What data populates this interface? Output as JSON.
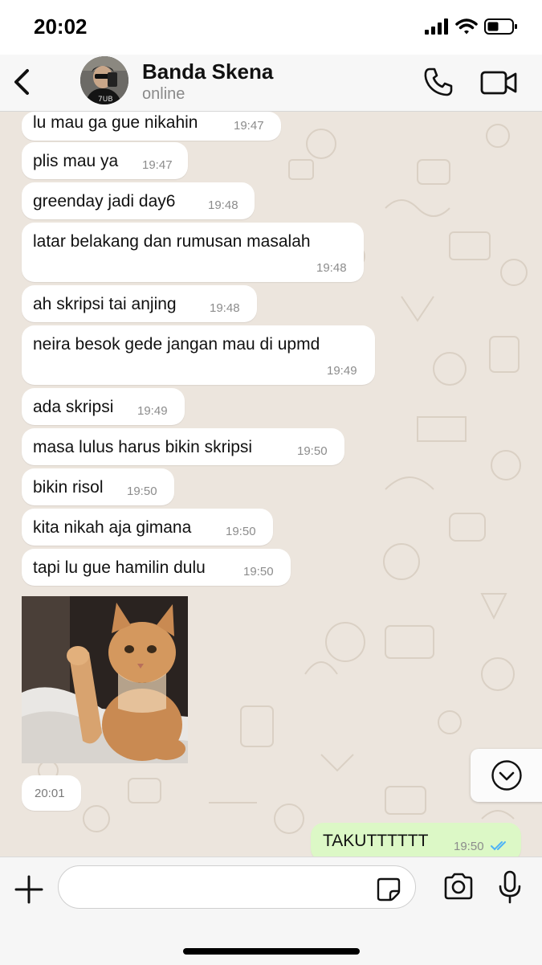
{
  "status_bar": {
    "time": "20:02"
  },
  "header": {
    "contact_name": "Banda Skena",
    "presence": "online"
  },
  "messages": [
    {
      "text": "lu mau ga gue nikahin",
      "time": "19:47"
    },
    {
      "text": "plis mau ya",
      "time": "19:47"
    },
    {
      "text": "greenday jadi day6",
      "time": "19:48"
    },
    {
      "text": "latar belakang dan rumusan masalah",
      "time": "19:48"
    },
    {
      "text": "ah skripsi tai anjing",
      "time": "19:48"
    },
    {
      "text": "neira besok gede jangan mau di upmd",
      "time": "19:49"
    },
    {
      "text": "ada skripsi",
      "time": "19:49"
    },
    {
      "text": "masa lulus harus bikin skripsi",
      "time": "19:50"
    },
    {
      "text": "bikin risol",
      "time": "19:50"
    },
    {
      "text": "kita nikah aja gimana",
      "time": "19:50"
    },
    {
      "text": "tapi lu gue hamilin dulu",
      "time": "19:50"
    }
  ],
  "image_message": {
    "time": "20:01"
  },
  "outgoing": {
    "text": "TAKUTTTTTT",
    "time": "19:50",
    "status": "read"
  },
  "composer": {
    "value": ""
  },
  "colors": {
    "incoming_bubble": "#ffffff",
    "outgoing_bubble": "#dcf8c6",
    "read_ticks": "#4fb3f6",
    "chat_bg": "#ece5dd"
  }
}
